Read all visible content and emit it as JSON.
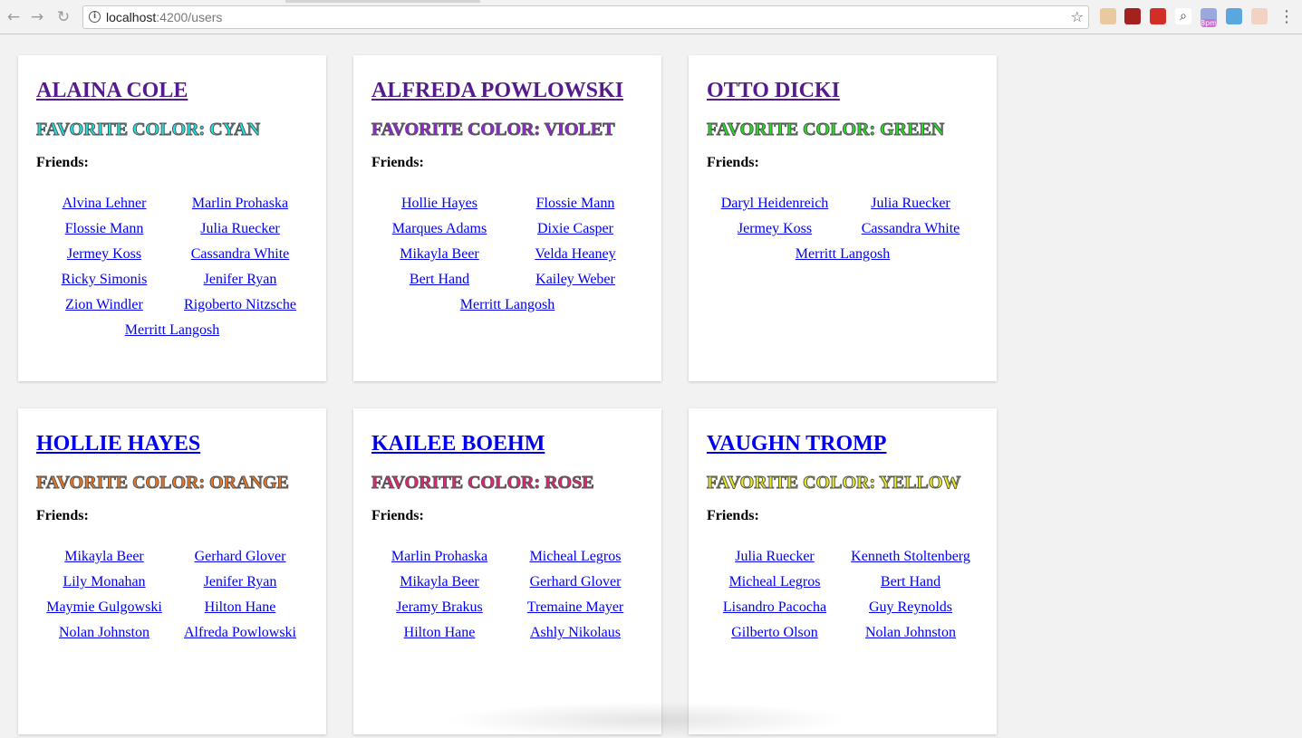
{
  "browser": {
    "url_host": "localhost",
    "url_rest": ":4200/users",
    "extensions": [
      {
        "icon": "face-extension-icon",
        "bg": "#e8c9a0"
      },
      {
        "icon": "ublock-origin-icon",
        "bg": "#a3211f"
      },
      {
        "icon": "lastpass-icon",
        "bg": "#d32d27"
      },
      {
        "icon": "zoom-icon",
        "bg": "#ffffff"
      },
      {
        "icon": "calendar-icon",
        "bg": "#9aa8e0",
        "label": "8pm"
      },
      {
        "icon": "window-icon",
        "bg": "#5aa6de"
      },
      {
        "icon": "avatar-extension-icon",
        "bg": "#f1d2c3"
      }
    ]
  },
  "users": [
    {
      "name": "ALAINA COLE",
      "name_color": "#551a8b",
      "favorite_color_text": "FAVORITE COLOR: CYAN",
      "favorite_color": "#19e6e6",
      "friends_label": "Friends:",
      "friends": [
        "Alvina Lehner",
        "Marlin Prohaska",
        "Flossie Mann",
        "Julia Ruecker",
        "Jermey Koss",
        "Cassandra White",
        "Ricky Simonis",
        "Jenifer Ryan",
        "Zion Windler",
        "Rigoberto Nitzsche",
        "Merritt Langosh"
      ]
    },
    {
      "name": "ALFREDA POWLOWSKI",
      "name_color": "#551a8b",
      "favorite_color_text": "FAVORITE COLOR: VIOLET",
      "favorite_color": "#9b1ee6",
      "friends_label": "Friends:",
      "friends": [
        "Hollie Hayes",
        "Flossie Mann",
        "Marques Adams",
        "Dixie Casper",
        "Mikayla Beer",
        "Velda Heaney",
        "Bert Hand",
        "Kailey Weber",
        "Merritt Langosh"
      ]
    },
    {
      "name": "OTTO DICKI",
      "name_color": "#551a8b",
      "favorite_color_text": "FAVORITE COLOR: GREEN",
      "favorite_color": "#1ee61e",
      "friends_label": "Friends:",
      "friends": [
        "Daryl Heidenreich",
        "Julia Ruecker",
        "Jermey Koss",
        "Cassandra White",
        "Merritt Langosh"
      ]
    },
    {
      "name": "HOLLIE HAYES",
      "name_color": "#0000ee",
      "favorite_color_text": "FAVORITE COLOR: ORANGE",
      "favorite_color": "#f0781e",
      "friends_label": "Friends:",
      "friends": [
        "Mikayla Beer",
        "Gerhard Glover",
        "Lily Monahan",
        "Jenifer Ryan",
        "Maymie Gulgowski",
        "Hilton Hane",
        "Nolan Johnston",
        "Alfreda Powlowski"
      ]
    },
    {
      "name": "KAILEE BOEHM",
      "name_color": "#0000ee",
      "favorite_color_text": "FAVORITE COLOR: ROSE",
      "favorite_color": "#f01e78",
      "friends_label": "Friends:",
      "friends": [
        "Marlin Prohaska",
        "Micheal Legros",
        "Mikayla Beer",
        "Gerhard Glover",
        "Jeramy Brakus",
        "Tremaine Mayer",
        "Hilton Hane",
        "Ashly Nikolaus"
      ]
    },
    {
      "name": "VAUGHN TROMP",
      "name_color": "#0000ee",
      "favorite_color_text": "FAVORITE COLOR: YELLOW",
      "favorite_color": "#f0f01e",
      "friends_label": "Friends:",
      "friends": [
        "Julia Ruecker",
        "Kenneth Stoltenberg",
        "Micheal Legros",
        "Bert Hand",
        "Lisandro Pacocha",
        "Guy Reynolds",
        "Gilberto Olson",
        "Nolan Johnston"
      ]
    }
  ]
}
